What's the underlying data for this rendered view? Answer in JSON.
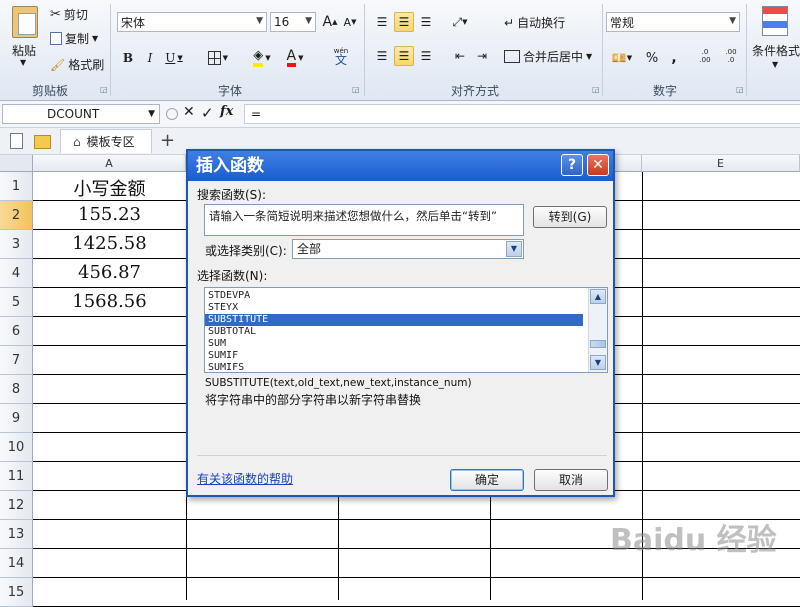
{
  "ribbon": {
    "clipboard": {
      "paste": "粘贴",
      "cut": "剪切",
      "copy": "复制",
      "format_painter": "格式刷",
      "group": "剪贴板"
    },
    "font": {
      "name": "宋体",
      "size": "16",
      "bold": "B",
      "italic": "I",
      "underline": "U",
      "grow": "A",
      "shrink": "A",
      "group": "字体",
      "wen": "wén"
    },
    "alignment": {
      "wrap": "自动换行",
      "merge": "合并后居中",
      "group": "对齐方式"
    },
    "number": {
      "format": "常规",
      "percent": "%",
      "comma": ",",
      "inc_decimal": ".0 .00",
      "dec_decimal": ".00 .0",
      "group": "数字"
    },
    "styles": {
      "conditional": "条件格式"
    }
  },
  "formula_bar": {
    "name_box": "DCOUNT",
    "cancel": "✕",
    "enter": "✓",
    "fx": "fx",
    "content": "="
  },
  "tabs": {
    "template_tab": "模板专区",
    "add": "+"
  },
  "columns": [
    "A",
    "E"
  ],
  "rows": [
    "1",
    "2",
    "3",
    "4",
    "5",
    "6",
    "7",
    "8",
    "9",
    "10",
    "11",
    "12",
    "13",
    "14",
    "15"
  ],
  "cells": {
    "A1": "小写金额",
    "A2": "155.23",
    "A3": "1425.58",
    "A4": "456.87",
    "A5": "1568.56"
  },
  "dialog": {
    "title": "插入函数",
    "help_btn": "?",
    "close_btn": "✕",
    "search_label": "搜索函数(S):",
    "search_value": "请输入一条简短说明来描述您想做什么，然后单击“转到”",
    "go_button": "转到(G)",
    "category_label": "或选择类别(C):",
    "category_value": "全部",
    "select_label": "选择函数(N):",
    "functions": [
      "STDEVPA",
      "STEYX",
      "SUBSTITUTE",
      "SUBTOTAL",
      "SUM",
      "SUMIF",
      "SUMIFS"
    ],
    "selected_function": "SUBSTITUTE",
    "syntax": "SUBSTITUTE(text,old_text,new_text,instance_num)",
    "description": "将字符串中的部分字符串以新字符串替换",
    "help_link": "有关该函数的帮助",
    "ok": "确定",
    "cancel": "取消"
  },
  "watermark": "Baidu 经验",
  "colors": {
    "title_bar": "#1a5ccf",
    "selection": "#316ac5",
    "close": "#d9432f",
    "active_row": "#f2c35c"
  }
}
